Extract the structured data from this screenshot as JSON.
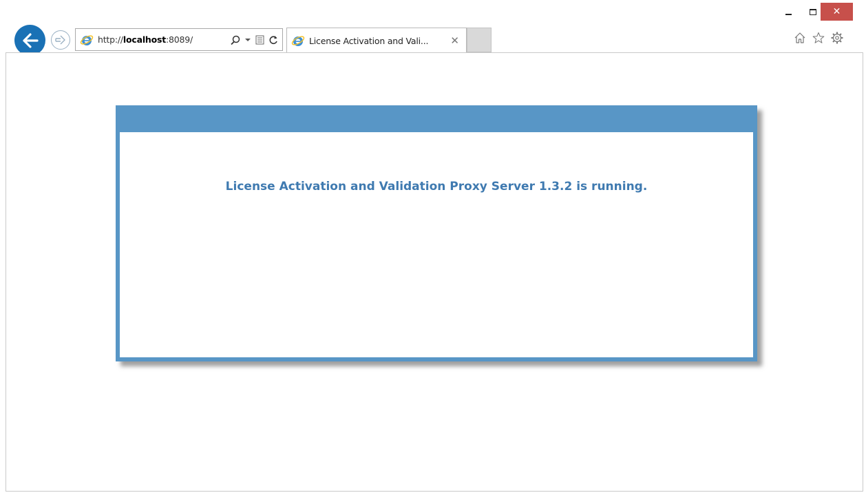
{
  "browser": {
    "address": {
      "prefix": "http://",
      "host": "localhost",
      "suffix": ":8089/"
    },
    "tab": {
      "title": "License Activation and Vali...",
      "close_glyph": "✕"
    },
    "window_controls": {
      "close_glyph": "✕"
    },
    "icons": [
      "back-arrow-icon",
      "forward-arrow-icon",
      "ie-logo-icon",
      "search-icon",
      "dropdown-caret-icon",
      "compatibility-view-icon",
      "refresh-icon",
      "home-icon",
      "favorites-star-icon",
      "settings-gear-icon"
    ],
    "accent_color": "#1a71b5"
  },
  "page": {
    "message": "License Activation and Validation Proxy Server 1.3.2 is running.",
    "panel_color": "#5896c6",
    "message_color": "#3f7ab0"
  }
}
